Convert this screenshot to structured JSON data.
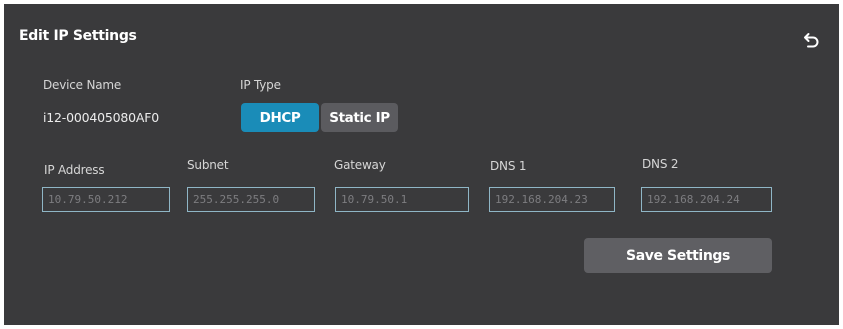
{
  "dialog": {
    "title": "Edit IP Settings",
    "back_icon": "undo-arrow-icon"
  },
  "device": {
    "name_label": "Device Name",
    "name_value": "i12-000405080AF0"
  },
  "ip_type": {
    "label": "IP Type",
    "options": [
      "DHCP",
      "Static IP"
    ],
    "selected": "DHCP",
    "active_color": "#1a8cb8",
    "inactive_color": "#5b5b5f"
  },
  "fields": {
    "ip_address": {
      "label": "IP Address",
      "placeholder": "10.79.50.212"
    },
    "subnet": {
      "label": "Subnet",
      "placeholder": "255.255.255.0"
    },
    "gateway": {
      "label": "Gateway",
      "placeholder": "10.79.50.1"
    },
    "dns1": {
      "label": "DNS 1",
      "placeholder": "192.168.204.23"
    },
    "dns2": {
      "label": "DNS 2",
      "placeholder": "192.168.204.24"
    }
  },
  "actions": {
    "save_label": "Save Settings"
  },
  "colors": {
    "panel_bg": "#3a3a3c",
    "field_border": "#8fb6c6"
  }
}
